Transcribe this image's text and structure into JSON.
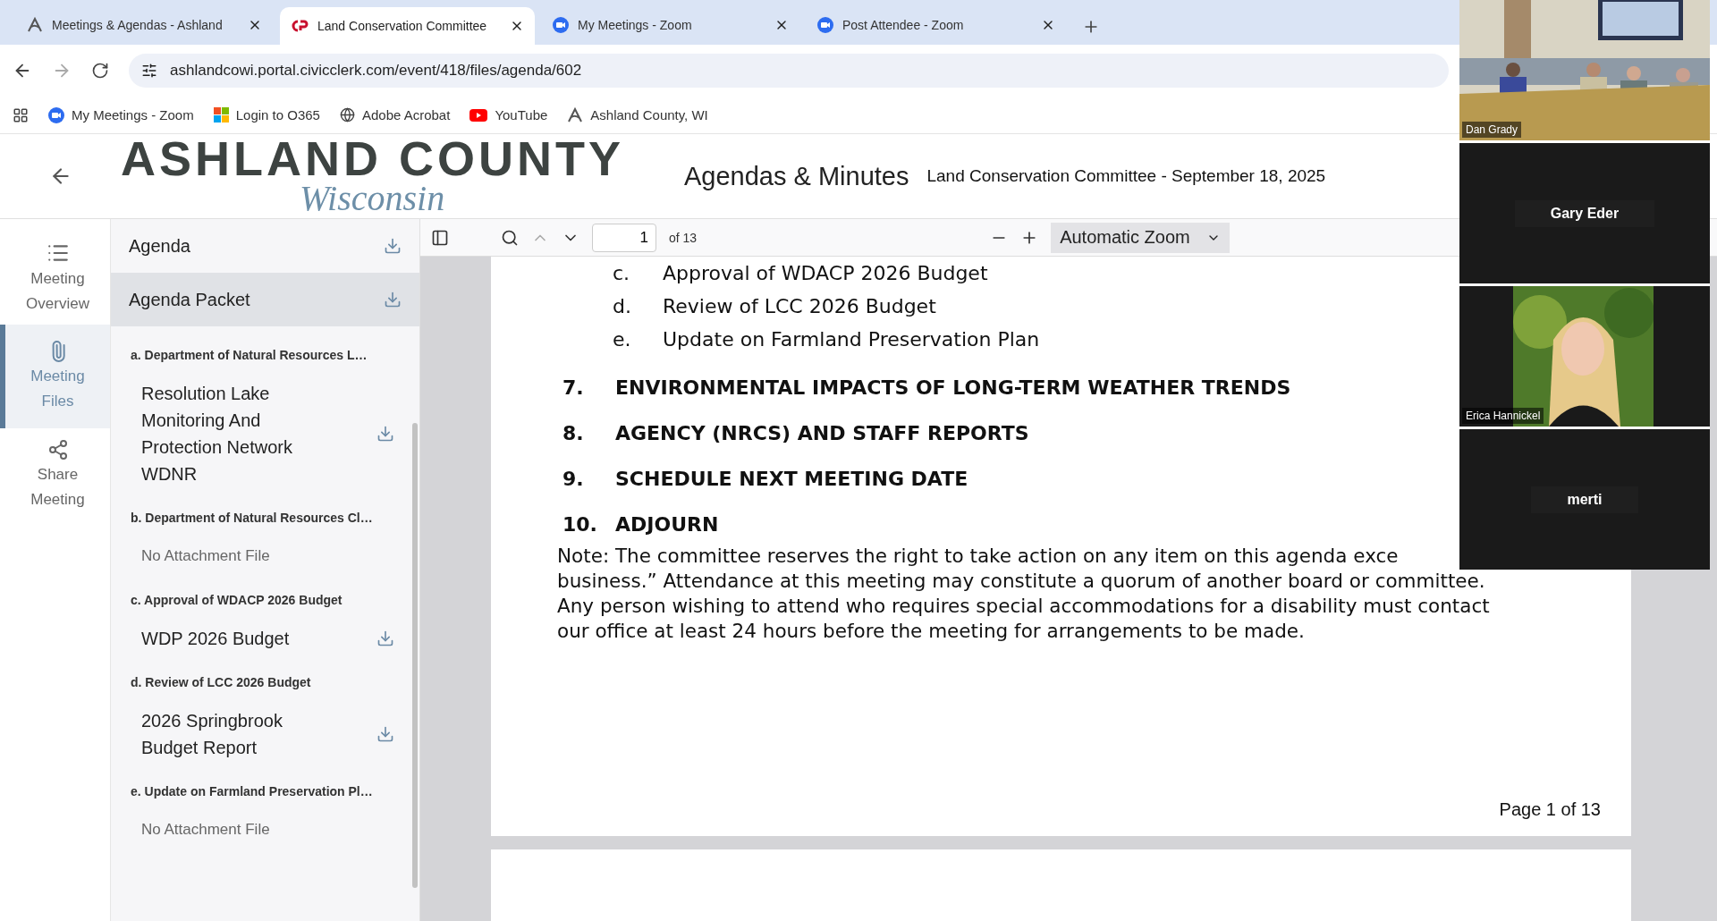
{
  "browser": {
    "tabs": [
      {
        "title": "Meetings & Agendas - Ashland",
        "kind": "county",
        "selected": false
      },
      {
        "title": "Land Conservation Committee",
        "kind": "clerk",
        "selected": true
      },
      {
        "title": "My Meetings - Zoom",
        "kind": "zoom",
        "selected": false
      },
      {
        "title": "Post Attendee - Zoom",
        "kind": "zoom",
        "selected": false
      }
    ],
    "address": "ashlandcowi.portal.civicclerk.com/event/418/files/agenda/602",
    "bookmarks": [
      {
        "label": "My Meetings - Zoom",
        "kind": "zoom"
      },
      {
        "label": "Login to O365",
        "kind": "windows"
      },
      {
        "label": "Adobe Acrobat",
        "kind": "globe"
      },
      {
        "label": "YouTube",
        "kind": "youtube"
      },
      {
        "label": "Ashland County, WI",
        "kind": "county"
      }
    ]
  },
  "header": {
    "logo_top": "ASHLAND COUNTY",
    "logo_script": "Wisconsin",
    "section": "Agendas & Minutes",
    "meeting_title": "Land Conservation Committee - September 18, 2025"
  },
  "nav": [
    {
      "label": "Meeting Overview",
      "kind": "list",
      "selected": false
    },
    {
      "label": "Meeting Files",
      "kind": "clip",
      "selected": true
    },
    {
      "label": "Share Meeting",
      "kind": "share",
      "selected": false
    }
  ],
  "documents": [
    {
      "label": "Agenda",
      "selected": false
    },
    {
      "label": "Agenda Packet",
      "selected": true
    }
  ],
  "attachments": [
    {
      "heading": "a. Department of Natural Resources L…",
      "files": [
        {
          "label": "Resolution Lake Monitoring And Protection Network WDNR",
          "kind": "file"
        }
      ]
    },
    {
      "heading": "b. Department of Natural Resources Cl…",
      "files": [
        {
          "label": "No Attachment File",
          "kind": "empty"
        }
      ]
    },
    {
      "heading": "c. Approval of WDACP 2026 Budget",
      "files": [
        {
          "label": "WDP 2026 Budget",
          "kind": "file"
        }
      ]
    },
    {
      "heading": "d. Review of LCC 2026 Budget",
      "files": [
        {
          "label": "2026 Springbrook Budget Report",
          "kind": "file"
        }
      ]
    },
    {
      "heading": "e. Update on Farmland Preservation Pl…",
      "files": [
        {
          "label": "No Attachment File",
          "kind": "empty"
        }
      ]
    }
  ],
  "viewer": {
    "page": "1",
    "page_count": "of 13",
    "zoom": "Automatic Zoom",
    "sub_items": [
      {
        "letter": "c.",
        "text": "Approval of WDACP 2026 Budget"
      },
      {
        "letter": "d.",
        "text": "Review of LCC 2026 Budget"
      },
      {
        "letter": "e.",
        "text": "Update on Farmland Preservation Plan"
      }
    ],
    "sections": [
      {
        "number": "7.",
        "title": "ENVIRONMENTAL IMPACTS OF LONG-TERM WEATHER TRENDS"
      },
      {
        "number": "8.",
        "title": "AGENCY (NRCS) AND STAFF REPORTS"
      },
      {
        "number": "9.",
        "title": "SCHEDULE NEXT MEETING DATE"
      },
      {
        "number": "10.",
        "title": "ADJOURN"
      }
    ],
    "note_lines": [
      "Note: The committee reserves the right to take action on any item on this agenda exce",
      "business.” Attendance at this meeting may constitute a quorum of another board or committee.",
      "Any person wishing to attend who requires special accommodations for a disability must contact",
      "our office at least 24 hours before the meeting for arrangements to be made."
    ],
    "footer": "Page 1 of 13"
  },
  "call": {
    "participants": [
      {
        "name": "Dan Grady",
        "kind": "room"
      },
      {
        "name": "Gary Eder",
        "kind": "off"
      },
      {
        "name": "Erica Hannickel"
      },
      {
        "name": "merti",
        "kind": "off"
      }
    ]
  }
}
